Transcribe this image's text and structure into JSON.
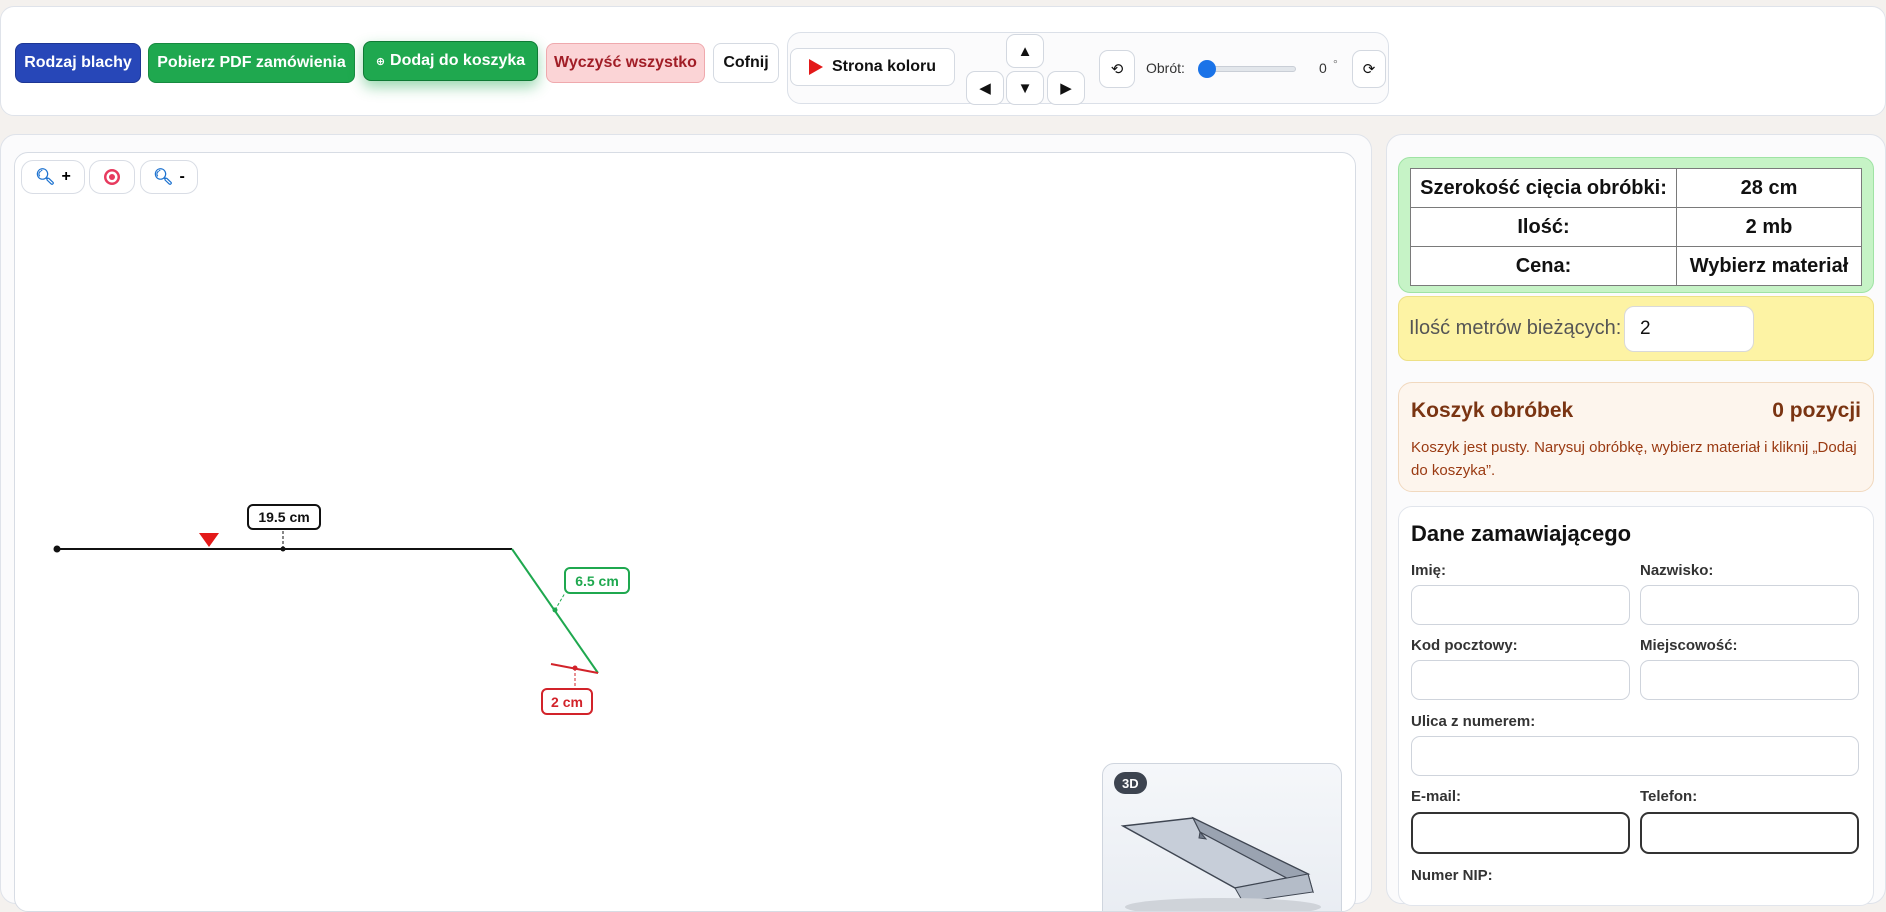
{
  "toolbar": {
    "sheet_type_label": "Rodzaj blachy",
    "download_pdf_label": "Pobierz PDF zamówienia",
    "add_to_cart_label": "Dodaj do koszyka",
    "clear_all_label": "Wyczyść wszystko",
    "undo_label": "Cofnij",
    "color_side_label": "Strona koloru",
    "rotation_label": "Obrót:",
    "rotation_value": "0",
    "rotation_unit": "°",
    "rotation_level": 0
  },
  "canvas": {
    "zoom_in_label": "+",
    "zoom_out_label": "-",
    "segments": [
      {
        "label": "19.5 cm",
        "color": "#111111"
      },
      {
        "label": "6.5 cm",
        "color": "#1fa84f"
      },
      {
        "label": "2 cm",
        "color": "#d2232a"
      }
    ],
    "preview_badge": "3D"
  },
  "spec_table": {
    "rows": [
      {
        "label": "Szerokość cięcia obróbki:",
        "value": "28 cm"
      },
      {
        "label": "Ilość:",
        "value": "2 mb"
      },
      {
        "label": "Cena:",
        "value": "Wybierz materiał"
      }
    ]
  },
  "meters": {
    "label": "Ilość metrów bieżących:",
    "value": "2"
  },
  "cart": {
    "title": "Koszyk obróbek",
    "count": "0 pozycji",
    "empty_text": "Koszyk jest pusty. Narysuj obróbkę, wybierz materiał i kliknij „Dodaj do koszyka”."
  },
  "order": {
    "title": "Dane zamawiającego",
    "first_name_label": "Imię:",
    "last_name_label": "Nazwisko:",
    "postal_code_label": "Kod pocztowy:",
    "city_label": "Miejscowość:",
    "street_label": "Ulica z numerem:",
    "email_label": "E-mail:",
    "phone_label": "Telefon:",
    "nip_label": "Numer NIP:"
  },
  "colors": {
    "primary_blue": "#2747b8",
    "green": "#1fa84f",
    "red": "#d2232a",
    "accent_slider": "#1a73e8"
  }
}
